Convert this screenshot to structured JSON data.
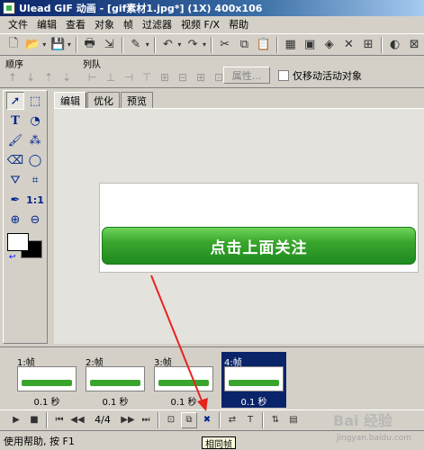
{
  "window": {
    "title": "Ulead GIF 动画 - [gif素材1.jpg*] (1X) 400x106"
  },
  "menu": [
    "文件",
    "编辑",
    "查看",
    "对象",
    "帧",
    "过滤器",
    "视频 F/X",
    "帮助"
  ],
  "toolbar2": {
    "order_label": "顺序",
    "align_label": "列队",
    "attr_button": "属性...",
    "checkbox_label": "仅移动活动对象"
  },
  "tabs": [
    "编辑",
    "优化",
    "预览"
  ],
  "canvas": {
    "button_text": "点击上面关注"
  },
  "frames": [
    {
      "label": "1:帧",
      "time": "0.1 秒"
    },
    {
      "label": "2:帧",
      "time": "0.1 秒"
    },
    {
      "label": "3:帧",
      "time": "0.1 秒"
    },
    {
      "label": "4:帧",
      "time": "0.1 秒"
    }
  ],
  "controls": {
    "frame_counter": "4/4"
  },
  "tooltip": "相同帧",
  "status": "使用帮助, 按 F1",
  "watermark": {
    "main": "Bai 经验",
    "sub": "jingyan.baidu.com"
  }
}
